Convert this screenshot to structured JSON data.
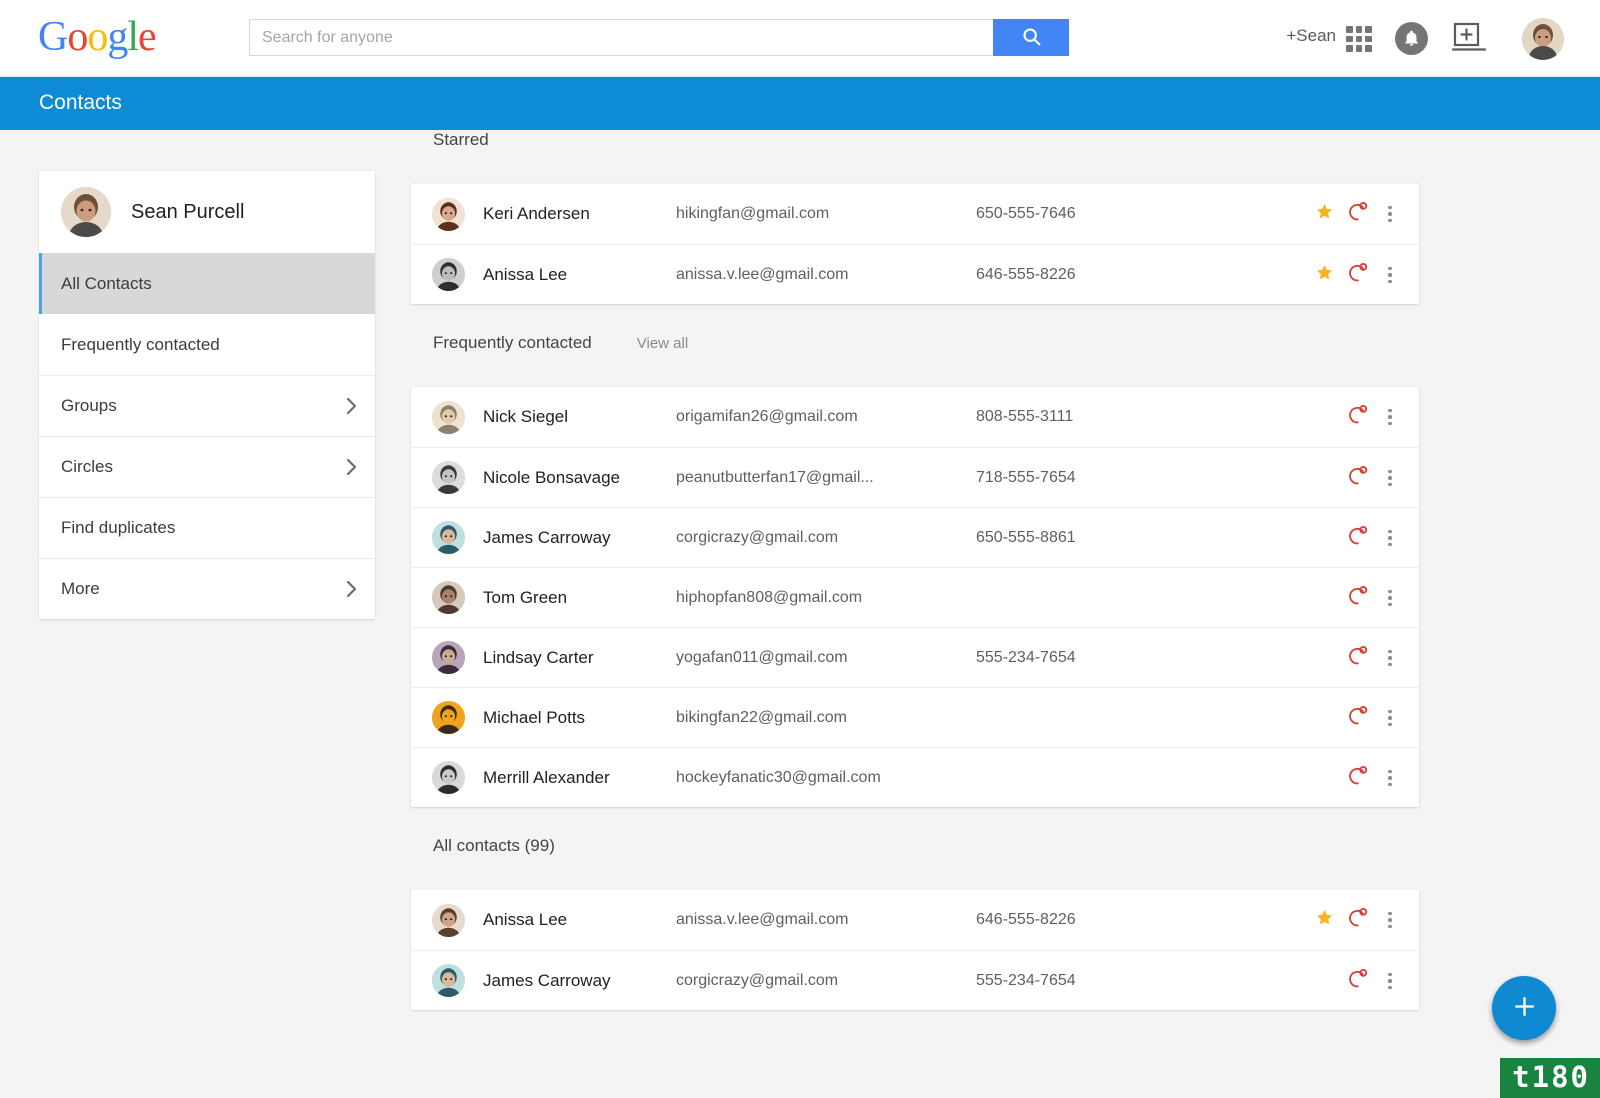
{
  "header": {
    "logo_text": "Google",
    "logo_letters": [
      "G",
      "o",
      "o",
      "g",
      "l",
      "e"
    ],
    "search": {
      "placeholder": "Search for anyone",
      "value": "",
      "button_icon": "search-icon"
    },
    "plus_user": "+Sean",
    "icons": [
      "apps-grid-icon",
      "notifications-bell-icon",
      "share-screen-icon",
      "account-avatar"
    ]
  },
  "banner": {
    "title": "Contacts",
    "color": "#0d8bd4"
  },
  "sidebar": {
    "profile": {
      "name": "Sean Purcell",
      "avatar": "user-avatar"
    },
    "items": [
      {
        "label": "All Contacts",
        "active": true,
        "chevron": false
      },
      {
        "label": "Frequently contacted",
        "active": false,
        "chevron": false
      },
      {
        "label": "Groups",
        "active": false,
        "chevron": true
      },
      {
        "label": "Circles",
        "active": false,
        "chevron": true
      },
      {
        "label": "Find duplicates",
        "active": false,
        "chevron": false
      },
      {
        "label": "More",
        "active": false,
        "chevron": true
      }
    ]
  },
  "main": {
    "sections": [
      {
        "title": "Starred",
        "link": "",
        "rows": [
          {
            "name": "Keri Andersen",
            "email": "hikingfan@gmail.com",
            "phone": "650-555-7646",
            "starred": true
          },
          {
            "name": "Anissa Lee",
            "email": "anissa.v.lee@gmail.com",
            "phone": "646-555-8226",
            "starred": true
          }
        ]
      },
      {
        "title": "Frequently contacted",
        "link": "View all",
        "rows": [
          {
            "name": "Nick Siegel",
            "email": "origamifan26@gmail.com",
            "phone": "808-555-3111",
            "starred": false
          },
          {
            "name": "Nicole Bonsavage",
            "email": "peanutbutterfan17@gmail...",
            "phone": "718-555-7654",
            "starred": false
          },
          {
            "name": "James Carroway",
            "email": "corgicrazy@gmail.com",
            "phone": "650-555-8861",
            "starred": false
          },
          {
            "name": "Tom Green",
            "email": "hiphopfan808@gmail.com",
            "phone": "",
            "starred": false
          },
          {
            "name": "Lindsay Carter",
            "email": "yogafan011@gmail.com",
            "phone": "555-234-7654",
            "starred": false
          },
          {
            "name": "Michael Potts",
            "email": "bikingfan22@gmail.com",
            "phone": "",
            "starred": false
          },
          {
            "name": "Merrill Alexander",
            "email": "hockeyfanatic30@gmail.com",
            "phone": "",
            "starred": false
          }
        ]
      },
      {
        "title": "All contacts (99)",
        "link": "",
        "rows": [
          {
            "name": "Anissa Lee",
            "email": "anissa.v.lee@gmail.com",
            "phone": "646-555-8226",
            "starred": true
          },
          {
            "name": "James Carroway",
            "email": "corgicrazy@gmail.com",
            "phone": "555-234-7654",
            "starred": false
          }
        ]
      }
    ]
  },
  "fab": {
    "label": "+",
    "icon": "plus-icon",
    "color": "#1089d3"
  },
  "watermark": {
    "text": "t180",
    "color": "#18843f"
  },
  "colors": {
    "accent_blue": "#0d8bd4",
    "search_button_blue": "#4285f4",
    "star_gold": "#f6b425",
    "hangouts_red": "#db3e34",
    "page_background": "#f4f4f4"
  }
}
